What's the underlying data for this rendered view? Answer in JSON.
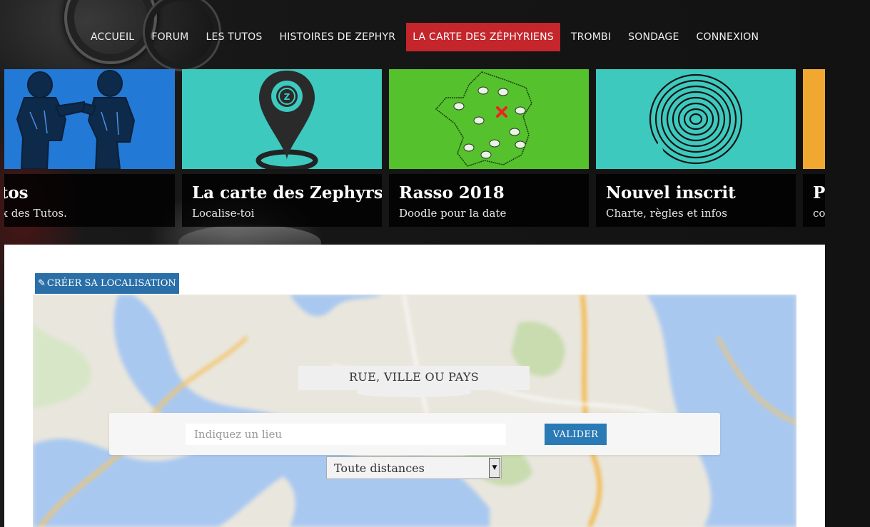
{
  "nav": {
    "items": [
      {
        "label": "ACCUEIL",
        "active": false
      },
      {
        "label": "FORUM",
        "active": false
      },
      {
        "label": "LES TUTOS",
        "active": false
      },
      {
        "label": "HISTOIRES DE ZEPHYR",
        "active": false
      },
      {
        "label": "LA CARTE DES ZÉPHYRIENS",
        "active": true
      },
      {
        "label": "TROMBI",
        "active": false
      },
      {
        "label": "SONDAGE",
        "active": false
      },
      {
        "label": "CONNEXION",
        "active": false
      }
    ],
    "active_color": "#c4262b"
  },
  "cards": [
    {
      "title": "utos",
      "subtitle": "dex des Tutos.",
      "color": "#2279d6",
      "icon": "bikers-fist-bump-icon"
    },
    {
      "title": "La carte des Zephyrs",
      "subtitle": "Localise-toi",
      "color": "#3ec9be",
      "icon": "map-pin-icon"
    },
    {
      "title": "Rasso 2018",
      "subtitle": "Doodle pour la date",
      "color": "#55c12d",
      "icon": "france-map-icon"
    },
    {
      "title": "Nouvel inscrit",
      "subtitle": "Charte, règles et infos",
      "color": "#3ec9be",
      "icon": "fingerprint-icon"
    },
    {
      "title": "P",
      "subtitle": "co",
      "color": "#f0a830",
      "icon": ""
    }
  ],
  "create_button": {
    "label": "CRÉER SA LOCALISATION",
    "color": "#2a6fa8"
  },
  "search": {
    "heading": "RUE, VILLE OU PAYS",
    "placeholder": "Indiquez un lieu",
    "submit_label": "VALIDER",
    "submit_color": "#2a7ab5",
    "distance_selected": "Toute distances"
  }
}
